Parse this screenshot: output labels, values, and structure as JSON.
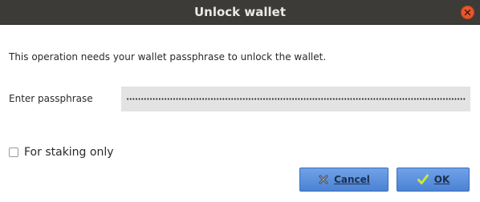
{
  "window": {
    "title": "Unlock wallet"
  },
  "dialog": {
    "message": "This operation needs your wallet passphrase to unlock the wallet.",
    "passphrase_label": "Enter passphrase",
    "passphrase_value": "••••••••••••••••••••••••••••••••••••••••••••••••••••••••••••••••••••••••••••••••••••••••••••••••••••••••••••••••••••••••••••••••••••••••••••••••",
    "staking_label": "For staking only",
    "staking_checked": false
  },
  "buttons": {
    "cancel_label": "Cancel",
    "ok_label": "OK"
  },
  "icons": {
    "close": "close-icon",
    "cancel": "x-icon",
    "ok": "checkmark-icon"
  },
  "colors": {
    "titlebar": "#3c3b37",
    "close_button": "#e9552d",
    "button_blue": "#5b8fdc",
    "input_bg": "#e3e3e3"
  }
}
